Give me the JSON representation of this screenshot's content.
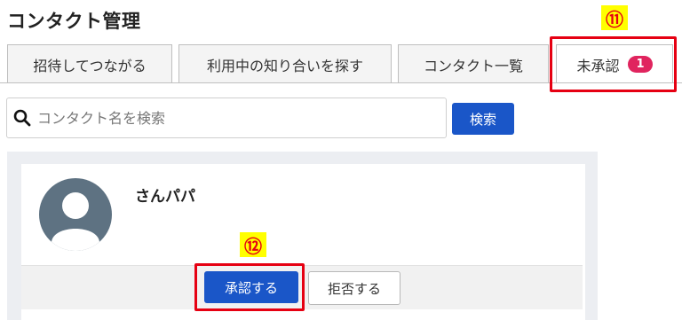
{
  "page": {
    "title": "コンタクト管理"
  },
  "tabs": [
    {
      "label": "招待してつながる"
    },
    {
      "label": "利用中の知り合いを探す"
    },
    {
      "label": "コンタクト一覧"
    },
    {
      "label": "未承認",
      "badge": "1"
    }
  ],
  "search": {
    "placeholder": "コンタクト名を検索",
    "button_label": "検索"
  },
  "contact": {
    "name": "さんパパ",
    "approve_label": "承認する",
    "reject_label": "拒否する"
  },
  "annotations": {
    "tab_marker": "⑪",
    "approve_marker": "⑫"
  },
  "colors": {
    "accent": "#1a56c8",
    "badge": "#e0245e",
    "annotation_border": "#e60012",
    "annotation_bg": "#ffff00"
  },
  "icons": {
    "search": "search-icon",
    "avatar": "user-silhouette-icon"
  }
}
